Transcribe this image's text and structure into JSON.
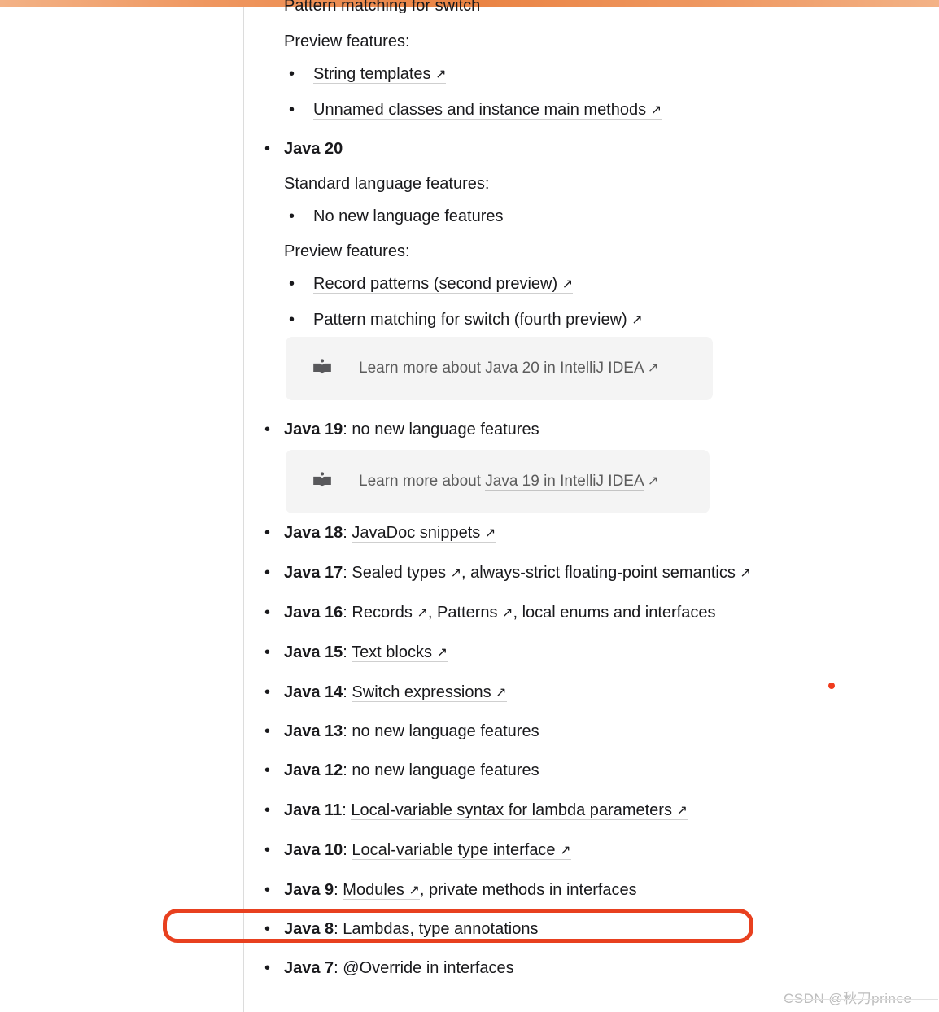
{
  "page": {
    "top_bar_color_left": "#f3b286",
    "top_bar_color_mid": "#ea8343",
    "highlight_ring_color": "#e8401f",
    "marker_dot_color": "#f03c1e"
  },
  "cut_off_line": {
    "text": "Pattern matching for switch"
  },
  "java21": {
    "preview_heading": "Preview features:",
    "preview_items": [
      {
        "label": "String templates",
        "arrow": "↗"
      },
      {
        "label": "Unnamed classes and instance main methods",
        "arrow": "↗"
      }
    ]
  },
  "java20": {
    "title": "Java 20",
    "standard_heading": "Standard language features:",
    "standard_items": [
      {
        "label": "No new language features"
      }
    ],
    "preview_heading": "Preview features:",
    "preview_items": [
      {
        "label": "Record patterns (second preview)",
        "arrow": "↗"
      },
      {
        "label": "Pattern matching for switch (fourth preview)",
        "arrow": "↗"
      }
    ],
    "callout": {
      "icon": "open-book-icon",
      "prefix": "Learn more about ",
      "link": "Java 20 in IntelliJ IDEA",
      "arrow": "↗"
    }
  },
  "java19": {
    "title": "Java 19",
    "rest": ": no new language features",
    "callout": {
      "icon": "open-book-icon",
      "prefix": "Learn more about ",
      "link": "Java 19 in IntelliJ IDEA",
      "arrow": "↗"
    }
  },
  "version_rows": [
    {
      "title": "Java 18",
      "segments": [
        {
          "type": "text",
          "text": ": "
        },
        {
          "type": "link",
          "text": "JavaDoc snippets",
          "arrow": "↗"
        }
      ]
    },
    {
      "title": "Java 17",
      "segments": [
        {
          "type": "text",
          "text": ": "
        },
        {
          "type": "link",
          "text": "Sealed types",
          "arrow": "↗"
        },
        {
          "type": "text",
          "text": ", "
        },
        {
          "type": "link",
          "text": "always-strict floating-point semantics",
          "arrow": "↗"
        }
      ]
    },
    {
      "title": "Java 16",
      "segments": [
        {
          "type": "text",
          "text": ": "
        },
        {
          "type": "link",
          "text": "Records",
          "arrow": "↗"
        },
        {
          "type": "text",
          "text": ", "
        },
        {
          "type": "link",
          "text": "Patterns",
          "arrow": "↗"
        },
        {
          "type": "text",
          "text": ", local enums and interfaces"
        }
      ]
    },
    {
      "title": "Java 15",
      "segments": [
        {
          "type": "text",
          "text": ": "
        },
        {
          "type": "link",
          "text": "Text blocks",
          "arrow": "↗"
        }
      ]
    },
    {
      "title": "Java 14",
      "segments": [
        {
          "type": "text",
          "text": ": "
        },
        {
          "type": "link",
          "text": "Switch expressions",
          "arrow": "↗"
        }
      ]
    },
    {
      "title": "Java 13",
      "segments": [
        {
          "type": "text",
          "text": ": no new language features"
        }
      ]
    },
    {
      "title": "Java 12",
      "segments": [
        {
          "type": "text",
          "text": ": no new language features"
        }
      ]
    },
    {
      "title": "Java 11",
      "segments": [
        {
          "type": "text",
          "text": ": "
        },
        {
          "type": "link",
          "text": "Local-variable syntax for lambda parameters",
          "arrow": "↗"
        }
      ]
    },
    {
      "title": "Java 10",
      "segments": [
        {
          "type": "text",
          "text": ": "
        },
        {
          "type": "link",
          "text": "Local-variable type interface",
          "arrow": "↗"
        }
      ]
    },
    {
      "title": "Java 9",
      "segments": [
        {
          "type": "text",
          "text": ": "
        },
        {
          "type": "link",
          "text": "Modules",
          "arrow": "↗"
        },
        {
          "type": "text",
          "text": ", private methods in interfaces"
        }
      ]
    },
    {
      "title": "Java 8",
      "highlighted": true,
      "segments": [
        {
          "type": "text",
          "text": ": Lambdas, type annotations"
        }
      ]
    },
    {
      "title": "Java 7",
      "segments": [
        {
          "type": "text",
          "text": ": @Override in interfaces"
        }
      ]
    }
  ],
  "watermark": {
    "text": "CSDN @秋刀prince"
  },
  "bullet_glyph": "•"
}
